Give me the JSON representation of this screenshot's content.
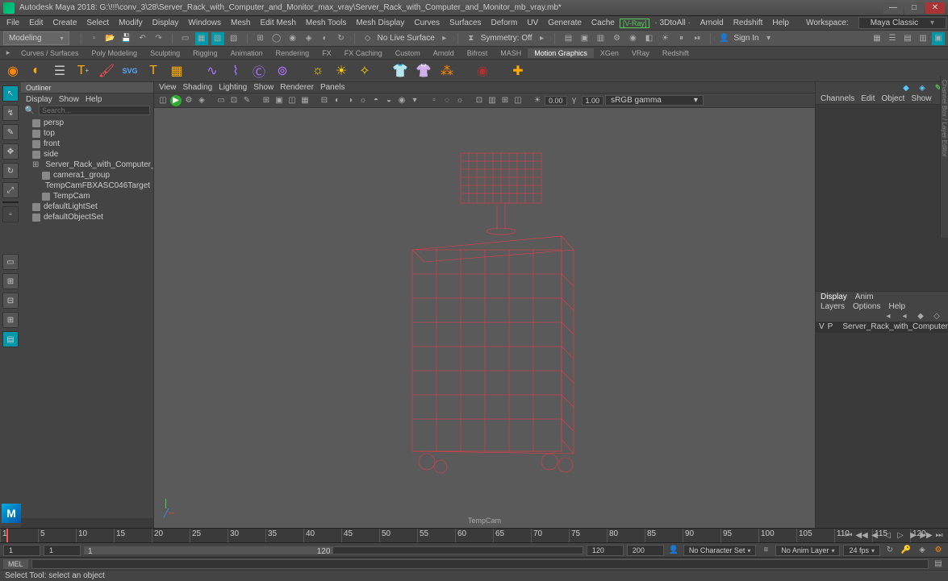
{
  "app": {
    "title": "Autodesk Maya 2018: G:\\!!!\\conv_3\\28\\Server_Rack_with_Computer_and_Monitor_max_vray\\Server_Rack_with_Computer_and_Monitor_mb_vray.mb*"
  },
  "window": {
    "min": "—",
    "max": "□",
    "close": "✕"
  },
  "mainmenu": [
    "File",
    "Edit",
    "Create",
    "Select",
    "Modify",
    "Display",
    "Windows",
    "Mesh",
    "Edit Mesh",
    "Mesh Tools",
    "Mesh Display",
    "Curves",
    "Surfaces",
    "Deform",
    "UV",
    "Generate",
    "Cache"
  ],
  "mainmenu2": [
    "· 3DtoAll ·",
    "Arnold",
    "Redshift",
    "Help"
  ],
  "vray": "[V-Ray]",
  "workspace": {
    "label": "Workspace:",
    "value": "Maya Classic"
  },
  "modeMenu": "Modeling",
  "statusline": {
    "noLive": "No Live Surface",
    "symmetry": "Symmetry: Off",
    "signin": "Sign In"
  },
  "shelftabs": [
    "Curves / Surfaces",
    "Poly Modeling",
    "Sculpting",
    "Rigging",
    "Animation",
    "Rendering",
    "FX",
    "FX Caching",
    "Custom",
    "Arnold",
    "Bifrost",
    "MASH",
    "Motion Graphics",
    "XGen",
    "VRay",
    "Redshift"
  ],
  "activeShelf": "Motion Graphics",
  "outliner": {
    "title": "Outliner",
    "menus": [
      "Display",
      "Show",
      "Help"
    ],
    "search": "Search...",
    "nodes": [
      {
        "label": "persp",
        "dim": true,
        "indent": 1
      },
      {
        "label": "top",
        "dim": true,
        "indent": 1
      },
      {
        "label": "front",
        "dim": true,
        "indent": 1
      },
      {
        "label": "side",
        "dim": true,
        "indent": 1
      },
      {
        "label": "Server_Rack_with_Computer_and_Mo",
        "dim": false,
        "indent": 1,
        "expander": "⊞"
      },
      {
        "label": "camera1_group",
        "dim": false,
        "indent": 2
      },
      {
        "label": "TempCamFBXASC046Target",
        "dim": false,
        "indent": 2,
        "icon": "✳"
      },
      {
        "label": "TempCam",
        "dim": false,
        "indent": 2
      },
      {
        "label": "defaultLightSet",
        "dim": false,
        "indent": 1
      },
      {
        "label": "defaultObjectSet",
        "dim": false,
        "indent": 1
      }
    ]
  },
  "viewpanel": {
    "menus": [
      "View",
      "Shading",
      "Lighting",
      "Show",
      "Renderer",
      "Panels"
    ],
    "exposure": "0.00",
    "gamma": "1.00",
    "colorSpace": "sRGB gamma",
    "camera": "TempCam"
  },
  "channelbox": {
    "menus": [
      "Channels",
      "Edit",
      "Object",
      "Show"
    ]
  },
  "layers": {
    "tabs": [
      "Display",
      "Anim"
    ],
    "activeTab": "Display",
    "menus": [
      "Layers",
      "Options",
      "Help"
    ],
    "row": {
      "v": "V",
      "p": "P",
      "name": "Server_Rack_with_Computer_a"
    }
  },
  "sidetext": "Channel Box / Layer Editor",
  "timeline": {
    "ticks": [
      "1",
      "5",
      "10",
      "15",
      "20",
      "25",
      "30",
      "35",
      "40",
      "45",
      "50",
      "55",
      "60",
      "65",
      "70",
      "75",
      "80",
      "85",
      "90",
      "95",
      "100",
      "105",
      "110",
      "115",
      "120"
    ]
  },
  "range": {
    "start": "1",
    "startAnim": "1",
    "cur": "1",
    "end": "120",
    "endRange": "120",
    "endAnim": "200",
    "charSet": "No Character Set",
    "animLayer": "No Anim Layer",
    "fps": "24 fps"
  },
  "cmd": {
    "lang": "MEL"
  },
  "helpline": "Select Tool: select an object"
}
